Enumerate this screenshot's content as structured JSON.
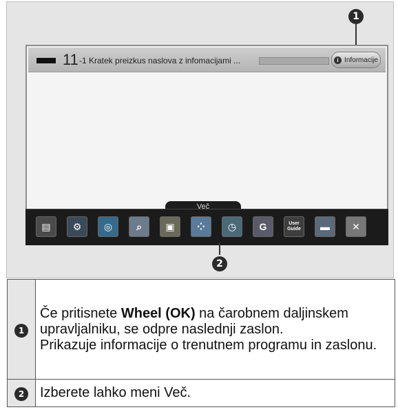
{
  "figure": {
    "marker1": "1",
    "marker2": "2",
    "infobar": {
      "channel_number": "11",
      "channel_title": "-1 Kratek preizkus naslova z infomacijami ...",
      "info_button_label": "Informacije"
    },
    "more_label": "Več",
    "apps": [
      {
        "name": "tv-guide-icon",
        "glyph": "▤",
        "bg": "#4a4a4a"
      },
      {
        "name": "settings-icon",
        "glyph": "⚙",
        "bg": "#3a4a5a"
      },
      {
        "name": "globe-icon",
        "glyph": "◎",
        "bg": "#356a8a"
      },
      {
        "name": "search-icon",
        "glyph": "⌕",
        "bg": "#6c7c8c"
      },
      {
        "name": "tv-icon",
        "glyph": "▣",
        "bg": "#6a6a5a"
      },
      {
        "name": "apps-icon",
        "glyph": "⁘",
        "bg": "#5a7a9a"
      },
      {
        "name": "clock-icon",
        "glyph": "◷",
        "bg": "#4a6a7a"
      },
      {
        "name": "game-icon",
        "glyph": "G",
        "bg": "#5a5a6a"
      },
      {
        "name": "user-guide-icon",
        "glyph": "User Guide",
        "bg": "#3e3e3e",
        "small": true
      },
      {
        "name": "video-icon",
        "glyph": "▬",
        "bg": "#5a6a7a"
      },
      {
        "name": "exit-icon",
        "glyph": "✕",
        "bg": "#777777"
      }
    ]
  },
  "table": {
    "row1_marker": "1",
    "row1_line1_before": "Če pritisnete ",
    "row1_bold": "Wheel (OK)",
    "row1_line1_after": " na čarobnem daljinskem upravljalniku, se odpre naslednji zaslon.",
    "row1_line2": "Prikazuje informacije o trenutnem programu in zaslonu.",
    "row2_marker": "2",
    "row2_text": "Izberete lahko meni Več."
  }
}
